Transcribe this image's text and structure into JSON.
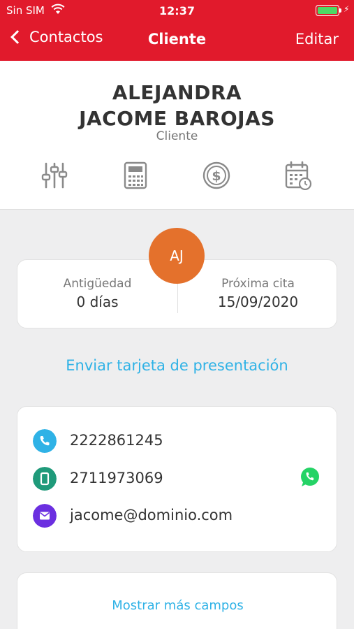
{
  "status_bar": {
    "carrier": "Sin SIM",
    "time": "12:37",
    "battery_level": 1.0
  },
  "nav": {
    "back_label": "Contactos",
    "title": "Cliente",
    "edit_label": "Editar"
  },
  "profile": {
    "name_line1": "ALEJANDRA",
    "name_line2": "JACOME BAROJAS",
    "role": "Cliente"
  },
  "actions": [
    "sliders-icon",
    "calculator-icon",
    "dollar-coin-icon",
    "calendar-clock-icon"
  ],
  "avatar": {
    "initials": "AJ",
    "color": "#e4712c"
  },
  "stats": [
    {
      "label": "Antigüedad",
      "value": "0 días"
    },
    {
      "label": "Próxima cita",
      "value": "15/09/2020"
    }
  ],
  "send_card_label": "Enviar tarjeta de presentación",
  "contact": {
    "phone": "2222861245",
    "mobile": "2711973069",
    "email": "jacome@dominio.com"
  },
  "show_more_label": "Mostrar más campos",
  "colors": {
    "header": "#e11a2c",
    "link": "#2fb2e6",
    "phone": "#2fb2e6",
    "mobile": "#1f9a7a",
    "email": "#6b2fe0",
    "whatsapp": "#25d366"
  }
}
